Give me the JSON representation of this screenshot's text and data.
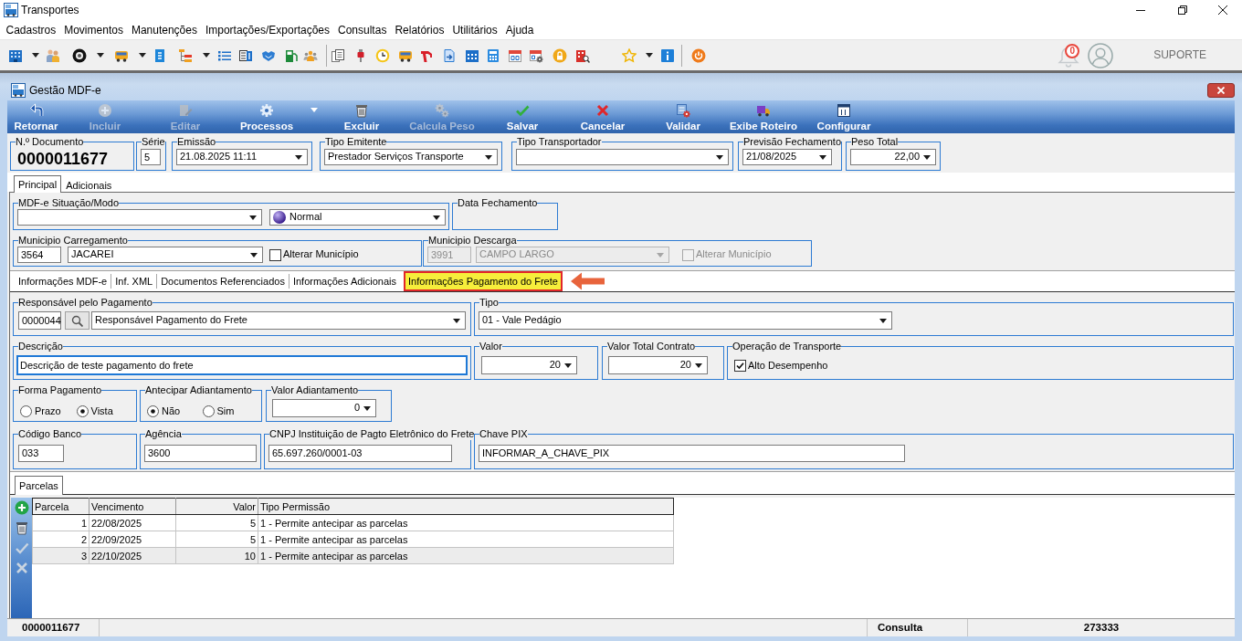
{
  "window": {
    "title": "Transportes"
  },
  "menu": [
    "Cadastros",
    "Movimentos",
    "Manutenções",
    "Importações/Exportações",
    "Consultas",
    "Relatórios",
    "Utilitários",
    "Ajuda"
  ],
  "user_area": {
    "notifications": "0",
    "user": "SUPORTE"
  },
  "child_window": {
    "title": "Gestão MDF-e"
  },
  "toolbar": [
    {
      "label": "Retornar",
      "disabled": false,
      "has_menu": false
    },
    {
      "label": "Incluir",
      "disabled": true,
      "has_menu": false
    },
    {
      "label": "Editar",
      "disabled": true,
      "has_menu": false
    },
    {
      "label": "Processos",
      "disabled": false,
      "has_menu": true
    },
    {
      "label": "Excluir",
      "disabled": false,
      "has_menu": false
    },
    {
      "label": "Calcula Peso",
      "disabled": true,
      "has_menu": false
    },
    {
      "label": "Salvar",
      "disabled": false,
      "has_menu": false
    },
    {
      "label": "Cancelar",
      "disabled": false,
      "has_menu": false
    },
    {
      "label": "Validar",
      "disabled": false,
      "has_menu": false
    },
    {
      "label": "Exibe Roteiro",
      "disabled": false,
      "has_menu": false
    },
    {
      "label": "Configurar",
      "disabled": false,
      "has_menu": false
    }
  ],
  "header_fields": [
    {
      "kind": "display",
      "label": "N.º Documento",
      "value": "0000011677"
    },
    {
      "kind": "input",
      "label": "Série",
      "value": "5"
    },
    {
      "kind": "select",
      "label": "Emissão",
      "value": "21.08.2025 11:11"
    },
    {
      "kind": "select",
      "label": "Tipo Emitente",
      "value": "Prestador Serviços Transporte"
    },
    {
      "kind": "select",
      "label": "Tipo Transportador"
    },
    {
      "kind": "select",
      "label": "Previsão Fechamento",
      "value": "21/08/2025"
    },
    {
      "kind": "select",
      "label": "Peso Total",
      "value": "22,00"
    }
  ],
  "main_tabs": [
    {
      "label": "Principal",
      "selected": true
    },
    {
      "label": "Adicionais",
      "selected": false
    }
  ],
  "situacao_modo": {
    "label": "MDF-e Situação/Modo",
    "modo": "Normal"
  },
  "data_fechamento": {
    "label": "Data Fechamento"
  },
  "municipios": [
    {
      "label": "Municipio Carregamento",
      "code": "3564",
      "name": "JACAREI",
      "disabled": false,
      "option": {
        "label": "Alterar Município",
        "checked": false
      }
    },
    {
      "label": "Municipio Descarga",
      "code": "3991",
      "name": "CAMPO LARGO",
      "disabled": true,
      "option": {
        "label": "Alterar Município",
        "checked": false
      }
    }
  ],
  "sub_tabs": [
    {
      "label": "Informações MDF-e",
      "selected": false,
      "highlighted": false
    },
    {
      "label": "Inf. XML",
      "selected": false,
      "highlighted": false
    },
    {
      "label": "Documentos Referenciados",
      "selected": false,
      "highlighted": false
    },
    {
      "label": "Informações Adicionais",
      "selected": false,
      "highlighted": false
    },
    {
      "label": "Informações Pagamento do Frete",
      "selected": true,
      "highlighted": true
    }
  ],
  "pagamento": {
    "responsavel": {
      "label": "Responsável pelo Pagamento",
      "code": "0000044",
      "name": "Responsável Pagamento do Frete"
    },
    "tipo": {
      "label": "Tipo",
      "value": "01 - Vale Pedágio"
    },
    "descricao": {
      "label": "Descrição",
      "value": "Descrição de teste pagamento do frete",
      "focused": true
    },
    "valor": {
      "label": "Valor",
      "value": "20"
    },
    "valor_total_contrato": {
      "label": "Valor Total Contrato",
      "value": "20"
    },
    "operacao_transporte": {
      "label": "Operação de Transporte",
      "option": {
        "label": "Alto Desempenho",
        "checked": true
      }
    },
    "forma_pagamento": {
      "label": "Forma Pagamento",
      "options": [
        {
          "label": "Prazo",
          "selected": false
        },
        {
          "label": "Vista",
          "selected": true
        }
      ]
    },
    "antecipar_adiantamento": {
      "label": "Antecipar Adiantamento",
      "options": [
        {
          "label": "Não",
          "selected": true
        },
        {
          "label": "Sim",
          "selected": false
        }
      ]
    },
    "valor_adiantamento": {
      "label": "Valor Adiantamento",
      "value": "0"
    },
    "codigo_banco": {
      "label": "Código Banco",
      "value": "033"
    },
    "agencia": {
      "label": "Agência",
      "value": "3600"
    },
    "cnpj": {
      "label": "CNPJ Instituição de Pagto Eletrônico do Frete",
      "value": "65.697.260/0001-03"
    },
    "chave_pix": {
      "label": "Chave PIX",
      "value": "INFORMAR_A_CHAVE_PIX"
    }
  },
  "parcelas": {
    "tabs": [
      {
        "label": "Parcelas",
        "selected": true
      }
    ],
    "tools": [
      {
        "kind": "add",
        "disabled": false
      },
      {
        "kind": "delete",
        "disabled": false
      },
      {
        "kind": "confirm",
        "disabled": true
      },
      {
        "kind": "cancel",
        "disabled": true
      }
    ],
    "table": {
      "columns": [
        "Parcela",
        "Vencimento",
        "Valor",
        "Tipo Permissão"
      ],
      "rows": [
        {
          "cells": [
            "1",
            "22/08/2025",
            "5",
            "1 - Permite antecipar as parcelas"
          ],
          "selected": false
        },
        {
          "cells": [
            "2",
            "22/09/2025",
            "5",
            "1 - Permite antecipar as parcelas"
          ],
          "selected": false
        },
        {
          "cells": [
            "3",
            "22/10/2025",
            "10",
            "1 - Permite antecipar as parcelas"
          ],
          "selected": true
        }
      ]
    }
  },
  "status_bar": {
    "document": "0000011677",
    "mode": "Consulta",
    "record": "273333"
  }
}
